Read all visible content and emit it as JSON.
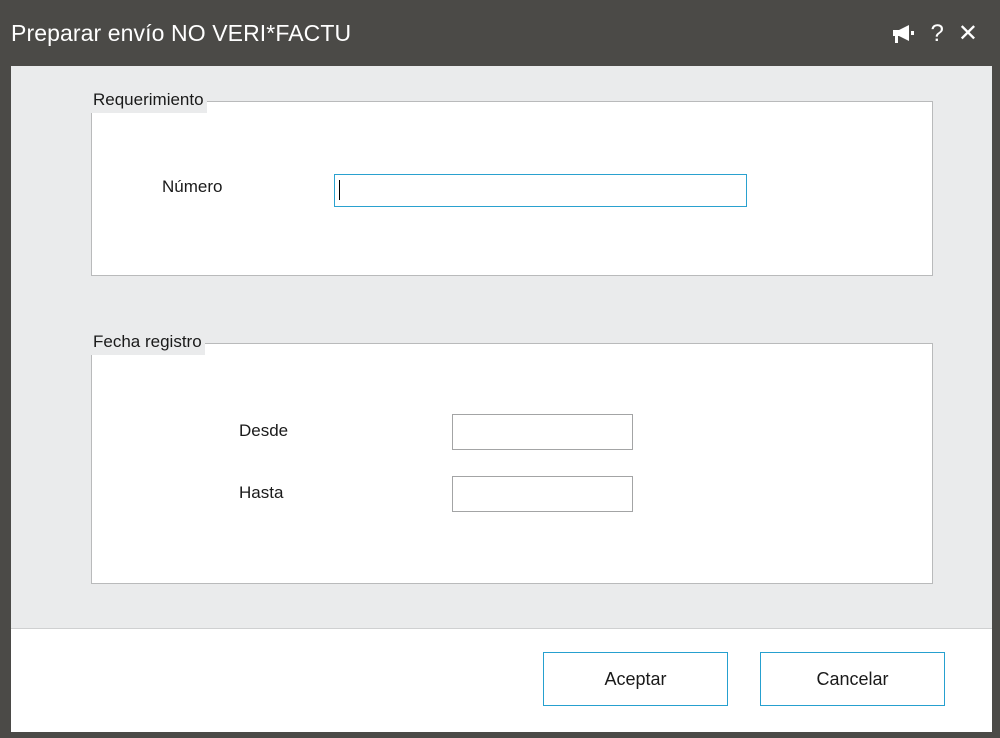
{
  "window": {
    "title": "Preparar envío NO VERI*FACTU",
    "icons": [
      "megaphone-icon",
      "help-icon",
      "close-icon"
    ],
    "help_glyph": "?",
    "close_glyph": "✕"
  },
  "requerimiento": {
    "legend": "Requerimiento",
    "numero_label": "Número",
    "numero_value": ""
  },
  "fecha_registro": {
    "legend": "Fecha registro",
    "desde_label": "Desde",
    "desde_value": "",
    "hasta_label": "Hasta",
    "hasta_value": ""
  },
  "buttons": {
    "accept": "Aceptar",
    "cancel": "Cancelar"
  },
  "colors": {
    "titlebar": "#4b4a47",
    "accent": "#2aa1cf",
    "panel": "#eaebec"
  }
}
